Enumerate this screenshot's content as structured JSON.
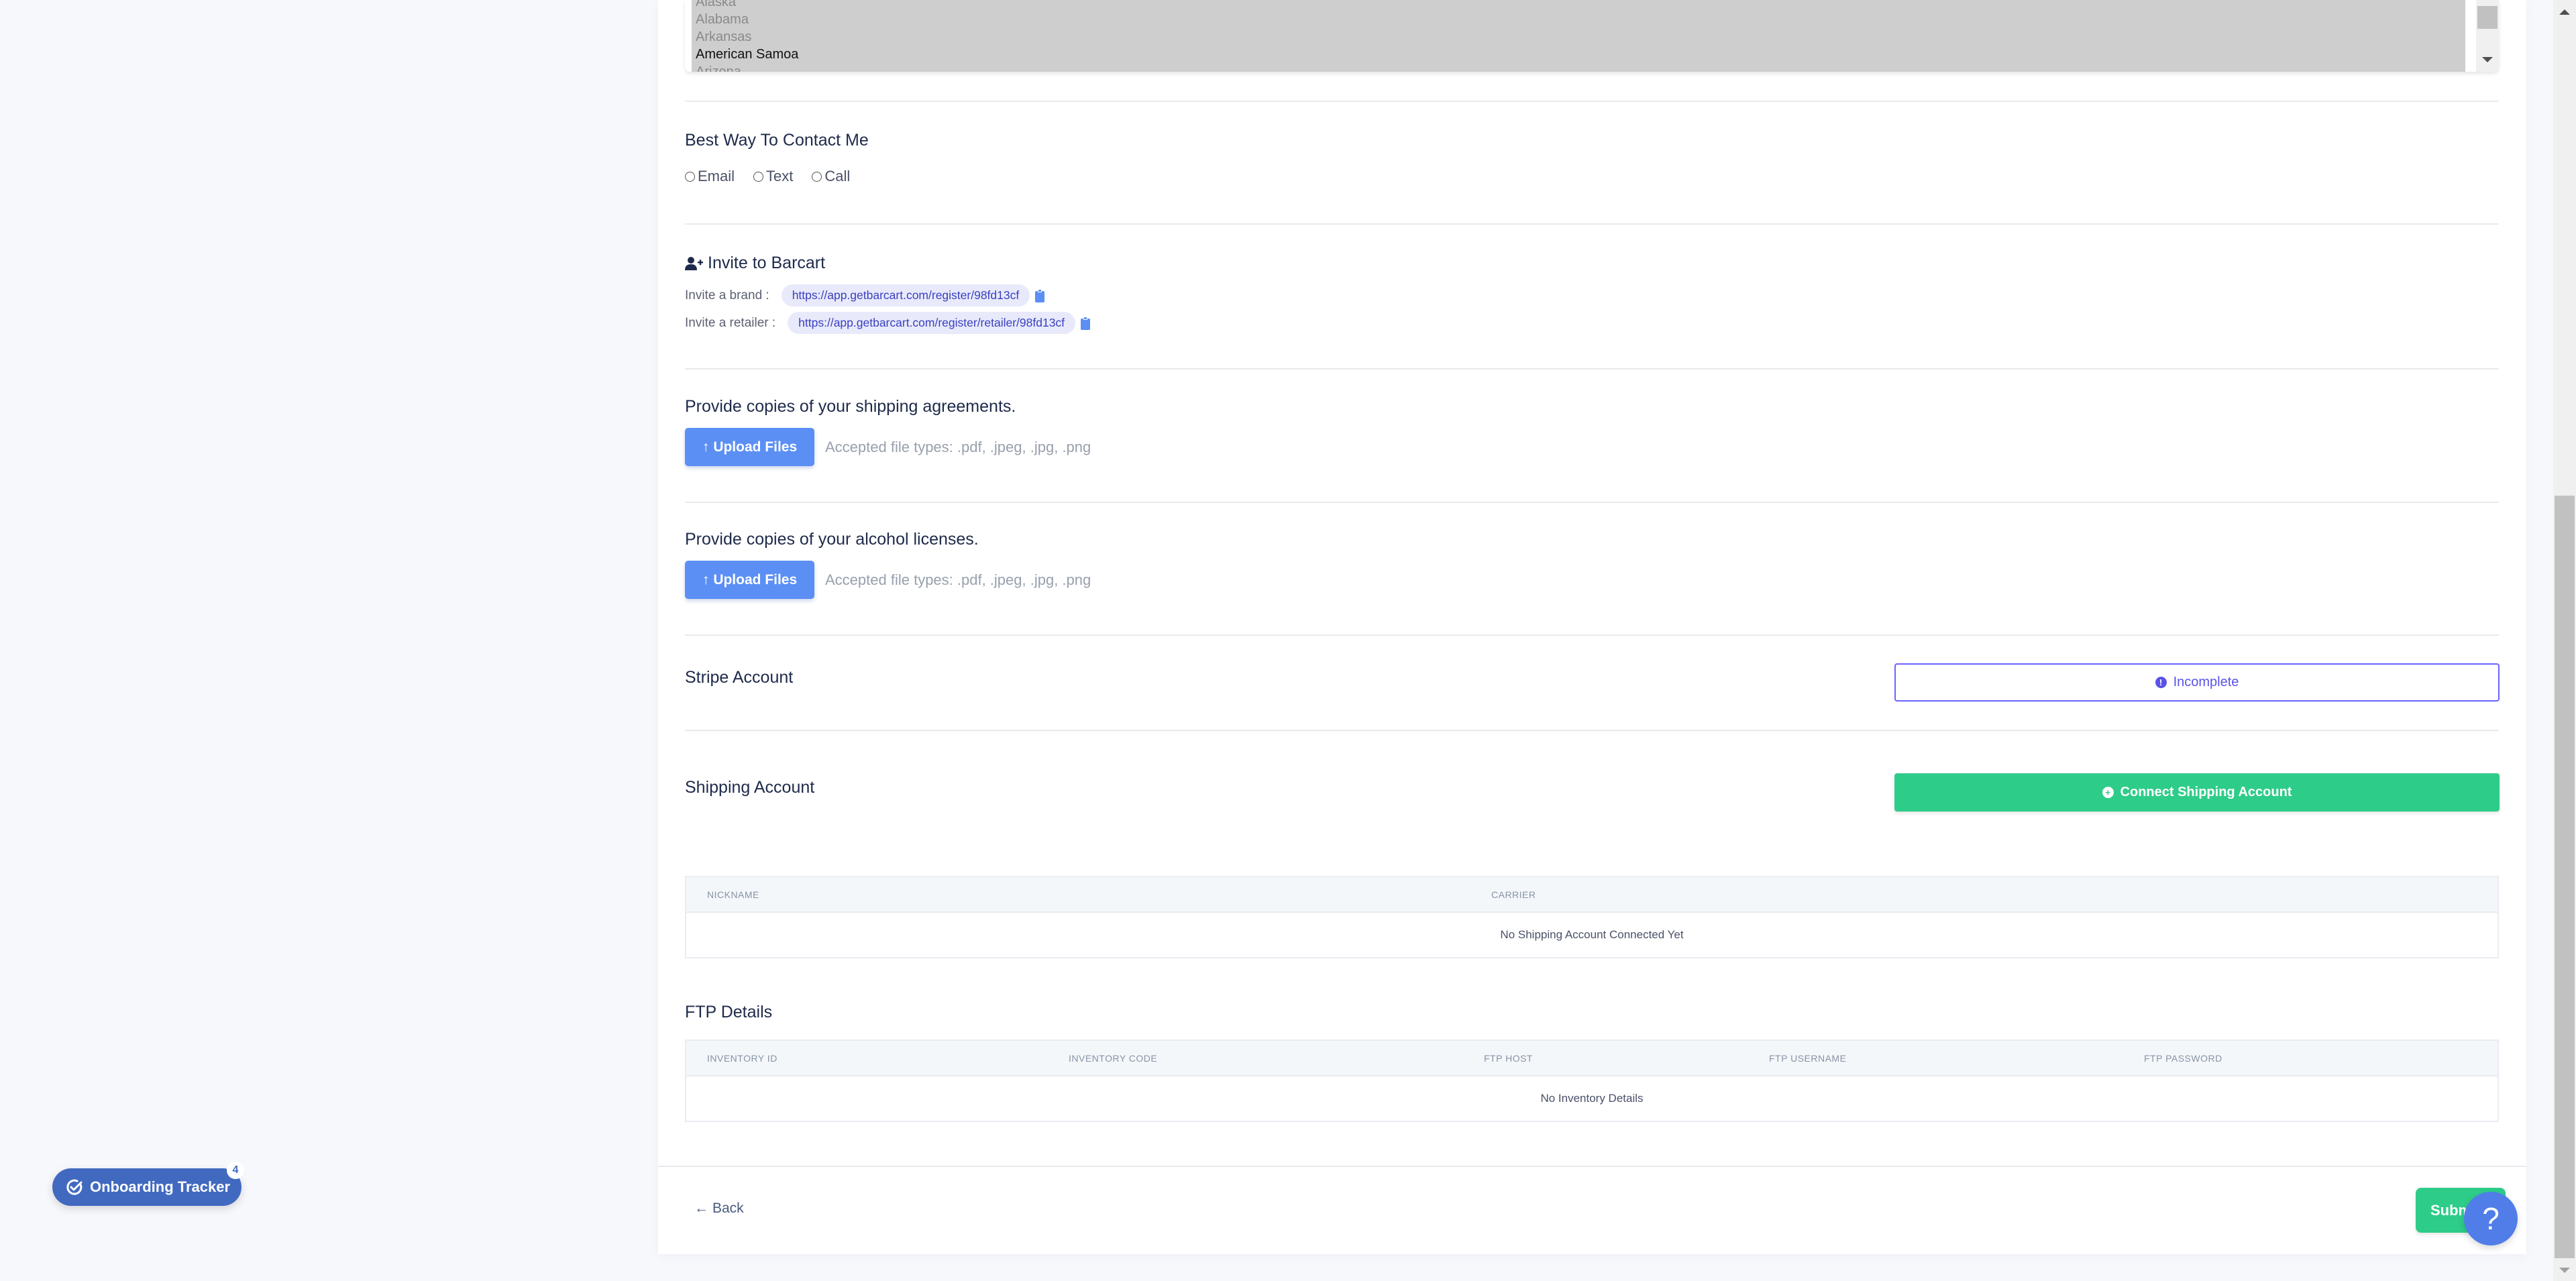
{
  "states_listbox": {
    "options": [
      {
        "label": "Alaska",
        "selected": false
      },
      {
        "label": "Alabama",
        "selected": false
      },
      {
        "label": "Arkansas",
        "selected": false
      },
      {
        "label": "American Samoa",
        "selected": true
      },
      {
        "label": "Arizona",
        "selected": false
      }
    ]
  },
  "contact": {
    "title": "Best Way To Contact Me",
    "options": [
      "Email",
      "Text",
      "Call"
    ]
  },
  "invite": {
    "title": "Invite to Barcart",
    "brand_label": "Invite a brand :",
    "brand_url": "https://app.getbarcart.com/register/98fd13cf",
    "retailer_label": "Invite a retailer :",
    "retailer_url": "https://app.getbarcart.com/register/retailer/98fd13cf"
  },
  "shipping_agreements": {
    "title": "Provide copies of your shipping agreements.",
    "button": "Upload Files",
    "accepted": "Accepted file types: .pdf, .jpeg, .jpg, .png"
  },
  "alcohol_licenses": {
    "title": "Provide copies of your alcohol licenses.",
    "button": "Upload Files",
    "accepted": "Accepted file types: .pdf, .jpeg, .jpg, .png"
  },
  "stripe": {
    "title": "Stripe Account",
    "status": "Incomplete"
  },
  "shipping_account": {
    "title": "Shipping Account",
    "button": "Connect Shipping Account",
    "table": {
      "columns": [
        "NICKNAME",
        "CARRIER"
      ],
      "empty": "No Shipping Account Connected Yet"
    }
  },
  "ftp": {
    "title": "FTP Details",
    "table": {
      "columns": [
        "INVENTORY ID",
        "INVENTORY CODE",
        "FTP HOST",
        "FTP USERNAME",
        "FTP PASSWORD"
      ],
      "empty": "No Inventory Details"
    }
  },
  "footer": {
    "back": "Back",
    "submit": "Submit",
    "help": "?"
  },
  "onboarding_tracker": {
    "label": "Onboarding Tracker",
    "count": "4"
  },
  "colors": {
    "primary_blue": "#5b8ff4",
    "green": "#2ecc89",
    "purple": "#5a52e8",
    "tracker_blue": "#4169c0"
  }
}
